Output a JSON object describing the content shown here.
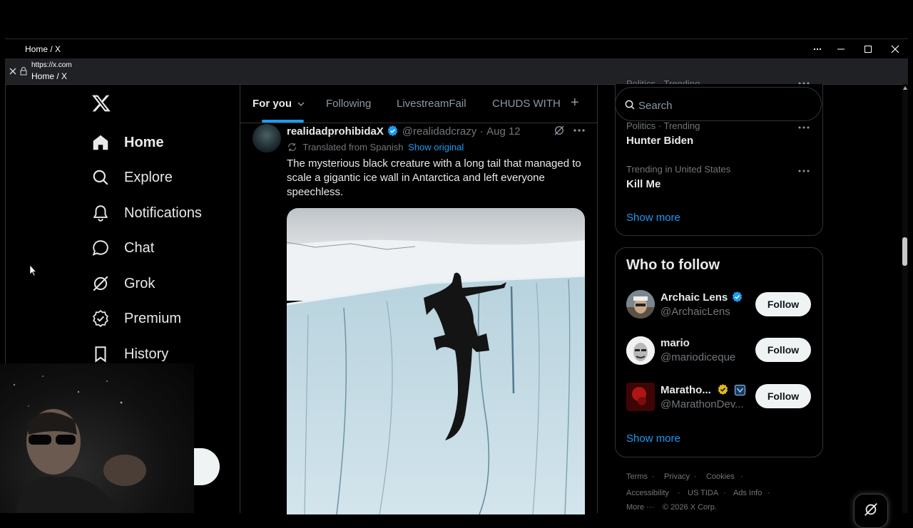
{
  "window": {
    "title": "Home / X",
    "url": "https://x.com",
    "url_title": "Home / X"
  },
  "nav": {
    "items": [
      {
        "label": "Home",
        "icon": "home-icon"
      },
      {
        "label": "Explore",
        "icon": "search-icon"
      },
      {
        "label": "Notifications",
        "icon": "bell-icon"
      },
      {
        "label": "Chat",
        "icon": "chat-bubble-icon"
      },
      {
        "label": "Grok",
        "icon": "grok-icon"
      },
      {
        "label": "Premium",
        "icon": "verified-badge-icon"
      },
      {
        "label": "History",
        "icon": "bookmark-icon"
      }
    ]
  },
  "tabs": {
    "for_you": "For you",
    "following": "Following",
    "livestreamfail": "LivestreamFail",
    "chuds": "CHUDS WITH",
    "add": "+"
  },
  "post": {
    "author": "realidadprohibidaX",
    "handle": "@realidadcrazy",
    "sep": "·",
    "date": "Aug 12",
    "translated": "Translated from Spanish",
    "show_original": "Show original",
    "text": "The mysterious black creature with a long tail that managed to scale a gigantic ice wall in Antarctica and left everyone speechless."
  },
  "search": {
    "placeholder": "Search"
  },
  "trends": {
    "partial_top": "Politics · Trending",
    "items": [
      {
        "category": "Politics · Trending",
        "name": "Hunter Biden"
      },
      {
        "category": "Trending in United States",
        "name": "Kill Me"
      }
    ],
    "show_more": "Show more"
  },
  "who_to_follow": {
    "title": "Who to follow",
    "users": [
      {
        "name": "Archaic Lens",
        "handle": "@ArchaicLens",
        "button": "Follow"
      },
      {
        "name": "mario",
        "handle": "@mariodiceque",
        "button": "Follow"
      },
      {
        "name": "Maratho...",
        "handle": "@MarathonDev...",
        "button": "Follow"
      }
    ],
    "show_more": "Show more"
  },
  "footer": {
    "terms": "Terms",
    "privacy": "Privacy",
    "cookies": "Cookies",
    "accessibility": "Accessibility",
    "us_tida": "US TIDA",
    "ads_info": "Ads Info",
    "more": "More ···",
    "copyright": "© 2026 X Corp.",
    "dot": "·"
  },
  "colors": {
    "accent": "#1d9bf0",
    "verified": "#1d9bf0",
    "gold_badge": "#e2b719",
    "background": "#000000",
    "border": "#2f3336"
  }
}
